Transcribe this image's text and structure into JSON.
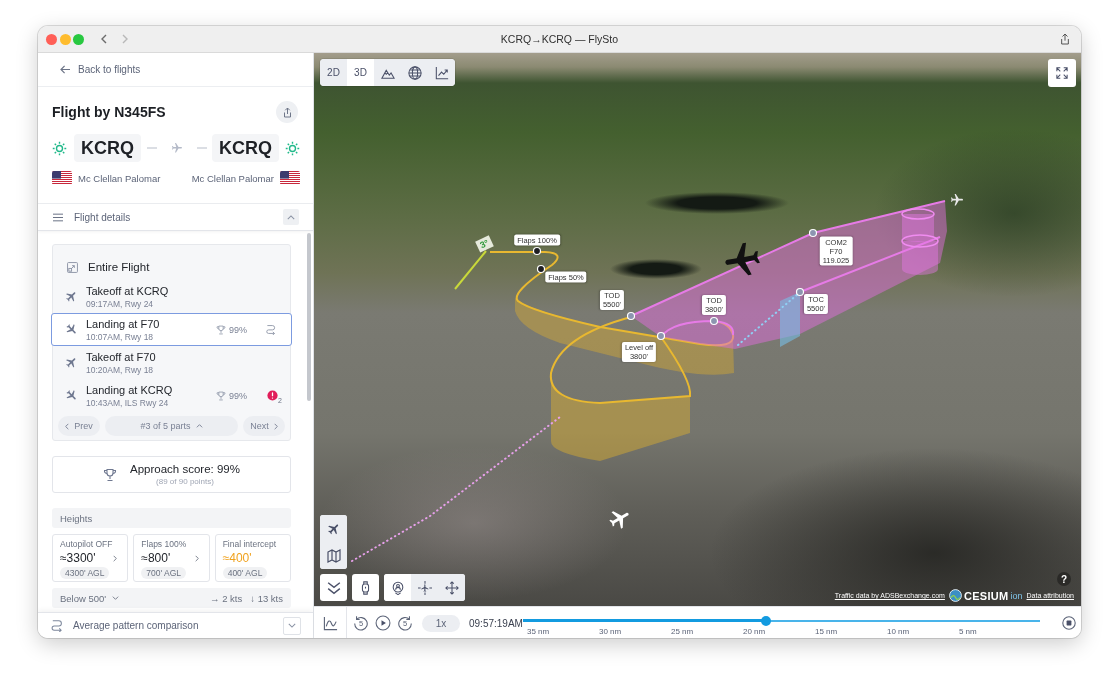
{
  "window": {
    "title": "KCRQ→KCRQ — FlySto"
  },
  "sidebar": {
    "back_link": "Back to flights",
    "title": "Flight by N345FS",
    "departure": {
      "code": "KCRQ",
      "name": "Mc Clellan Palomar"
    },
    "arrival": {
      "code": "KCRQ",
      "name": "Mc Clellan Palomar"
    },
    "details": {
      "label": "Flight details",
      "expanded": true
    },
    "parts": {
      "entire_flight": {
        "label": "Entire Flight",
        "selected": false
      },
      "items": [
        {
          "kind": "takeoff",
          "title": "Takeoff at KCRQ",
          "subtitle": "09:17AM, Rwy 24",
          "selected": false,
          "compare": false
        },
        {
          "kind": "landing",
          "title": "Landing at F70",
          "subtitle": "10:07AM, Rwy 18",
          "selected": true,
          "score": "99%",
          "compare": true
        },
        {
          "kind": "takeoff",
          "title": "Takeoff at F70",
          "subtitle": "10:20AM, Rwy 18",
          "selected": false,
          "compare": false
        },
        {
          "kind": "landing",
          "title": "Landing at KCRQ",
          "subtitle": "10:43AM, ILS Rwy 24",
          "selected": false,
          "score": "99%",
          "compare": false,
          "alerts": "2"
        }
      ],
      "prev": "Prev",
      "position": "#3 of 5 parts",
      "next": "Next"
    },
    "approach_score": {
      "label": "Approach score: 99%",
      "points": "(89 of 90 points)"
    },
    "heights": {
      "title": "Heights",
      "cards": [
        {
          "label": "Autopilot OFF",
          "value": "≈3300'",
          "agl": "4300' AGL",
          "caution": false,
          "link": true
        },
        {
          "label": "Flaps 100%",
          "value": "≈800'",
          "agl": "700' AGL",
          "caution": false,
          "link": true
        },
        {
          "label": "Final intercept",
          "value": "≈400'",
          "agl": "400' AGL",
          "caution": true,
          "link": false
        }
      ]
    },
    "below_500": {
      "label": "Below 500'",
      "expanded": false,
      "crosswind": "→ 2 kts",
      "headwind": "↓ 13 kts"
    },
    "comparison": {
      "label": "Average pattern comparison",
      "expanded": false
    }
  },
  "map": {
    "view_modes": [
      {
        "label": "2D",
        "selected": false
      },
      {
        "label": "3D",
        "selected": true
      }
    ],
    "glideslope": "3°",
    "labels": [
      {
        "lines": [
          "Flaps 100%"
        ],
        "color": "#1e1e22"
      },
      {
        "lines": [
          "Flaps 50%"
        ],
        "color": "#1e1e22"
      },
      {
        "lines": [
          "TOD",
          "5500'"
        ],
        "color": "#8c95b0"
      },
      {
        "lines": [
          "TOD",
          "3800'"
        ],
        "color": "#8c95b0"
      },
      {
        "lines": [
          "Level off",
          "3800'"
        ],
        "color": "#8c95b0"
      },
      {
        "lines": [
          "COM2",
          "F70",
          "119.025"
        ],
        "color": "#8c95b0"
      },
      {
        "lines": [
          "TOC",
          "5500'"
        ],
        "color": "#8c95b0"
      }
    ],
    "help": "?",
    "attribution": {
      "traffic": "Traffic data by ADSBexchange.com",
      "logo": "CESIUM",
      "logo_suffix": "ion",
      "data": "Data attribution"
    }
  },
  "timeline": {
    "rewind": "5",
    "forward": "5",
    "speed": "1x",
    "time": "09:57:19AM",
    "level": 0.47,
    "ticks": [
      "35 nm",
      "30 nm",
      "25 nm",
      "20 nm",
      "15 nm",
      "10 nm",
      "5 nm"
    ]
  }
}
